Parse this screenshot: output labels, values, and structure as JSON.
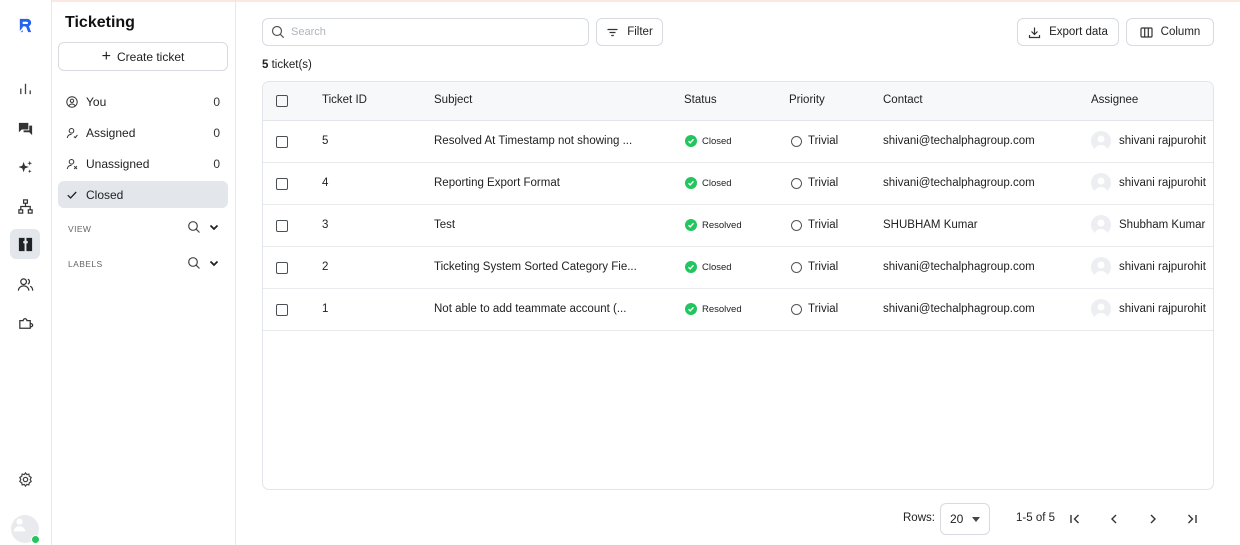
{
  "rail": {
    "items": [
      {
        "icon": "logo-icon"
      },
      {
        "icon": "analytics-icon"
      },
      {
        "icon": "chat-icon"
      },
      {
        "icon": "ai-sparkle-icon"
      },
      {
        "icon": "workflow-icon"
      },
      {
        "icon": "ticket-icon",
        "active": true
      },
      {
        "icon": "contacts-icon"
      },
      {
        "icon": "integrations-icon"
      },
      {
        "icon": "settings-icon"
      }
    ]
  },
  "sidebar": {
    "title": "Ticketing",
    "create_label": "Create ticket",
    "items": [
      {
        "label": "You",
        "count": "0",
        "icon": "user-circle-icon"
      },
      {
        "label": "Assigned",
        "count": "0",
        "icon": "user-assigned-icon"
      },
      {
        "label": "Unassigned",
        "count": "0",
        "icon": "user-unassigned-icon"
      },
      {
        "label": "Closed",
        "count": "",
        "icon": "check-icon",
        "active": true
      }
    ],
    "view_label": "VIEW",
    "labels_label": "LABELS"
  },
  "toolbar": {
    "search_placeholder": "Search",
    "filter_label": "Filter",
    "export_label": "Export data",
    "column_label": "Column"
  },
  "summary": {
    "count": "5",
    "suffix": "ticket(s)"
  },
  "table": {
    "headers": {
      "id": "Ticket ID",
      "subject": "Subject",
      "status": "Status",
      "priority": "Priority",
      "contact": "Contact",
      "assignee": "Assignee"
    },
    "rows": [
      {
        "id": "5",
        "subject": "Resolved At Timestamp not showing ...",
        "status": "Closed",
        "priority": "Trivial",
        "contact": "shivani@techalphagroup.com",
        "assignee": "shivani rajpurohit"
      },
      {
        "id": "4",
        "subject": "Reporting Export Format",
        "status": "Closed",
        "priority": "Trivial",
        "contact": "shivani@techalphagroup.com",
        "assignee": "shivani rajpurohit"
      },
      {
        "id": "3",
        "subject": "Test",
        "status": "Resolved",
        "priority": "Trivial",
        "contact": "SHUBHAM Kumar",
        "assignee": "Shubham Kumar"
      },
      {
        "id": "2",
        "subject": "Ticketing System Sorted Category Fie...",
        "status": "Closed",
        "priority": "Trivial",
        "contact": "shivani@techalphagroup.com",
        "assignee": "shivani rajpurohit"
      },
      {
        "id": "1",
        "subject": "Not able to add teammate account (...",
        "status": "Resolved",
        "priority": "Trivial",
        "contact": "shivani@techalphagroup.com",
        "assignee": "shivani rajpurohit"
      }
    ]
  },
  "pagination": {
    "rows_label": "Rows:",
    "rows_value": "20",
    "range": "1-5 of 5"
  },
  "colors": {
    "accent": "#2563eb",
    "status_green": "#22c55e",
    "active_bg": "#e3e7ec"
  }
}
